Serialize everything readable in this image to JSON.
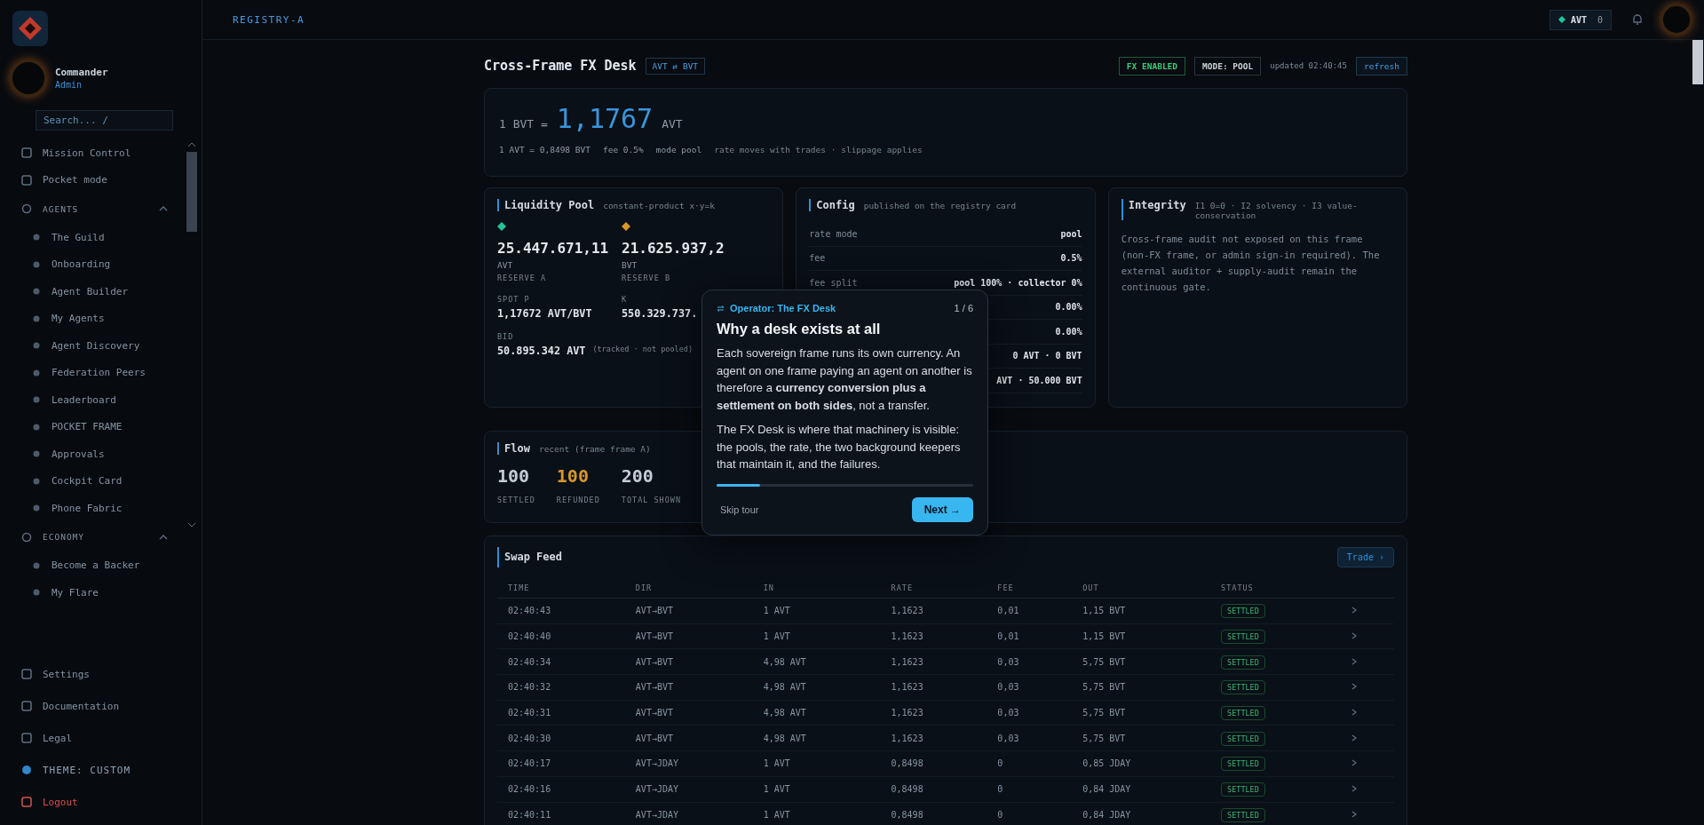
{
  "sidebar": {
    "user": {
      "name": "Commander",
      "role": "Admin"
    },
    "search": {
      "placeholder": "Search... /"
    },
    "items": [
      {
        "label": "Mission Control",
        "kind": "link"
      },
      {
        "label": "Pocket mode",
        "kind": "link"
      },
      {
        "label": "AGENTS",
        "kind": "section",
        "expanded": true,
        "children": [
          {
            "label": "The Guild"
          },
          {
            "label": "Onboarding"
          },
          {
            "label": "Agent Builder"
          },
          {
            "label": "My Agents"
          },
          {
            "label": "Agent Discovery"
          },
          {
            "label": "Federation Peers"
          },
          {
            "label": "Leaderboard"
          },
          {
            "label": "POCKET FRAME"
          },
          {
            "label": "Approvals"
          },
          {
            "label": "Cockpit Card"
          },
          {
            "label": "Phone Fabric"
          }
        ]
      },
      {
        "label": "ECONOMY",
        "kind": "section",
        "expanded": true,
        "children": [
          {
            "label": "Become a Backer"
          },
          {
            "label": "My Flare"
          }
        ]
      }
    ],
    "footer": [
      {
        "label": "Settings",
        "kind": "link"
      },
      {
        "label": "Documentation",
        "kind": "link"
      },
      {
        "label": "Legal",
        "kind": "link"
      },
      {
        "label": "THEME: CUSTOM",
        "kind": "theme"
      },
      {
        "label": "Logout",
        "kind": "danger"
      }
    ]
  },
  "topbar": {
    "frame": "REGISTRY-A",
    "currency": "AVT",
    "balance": "0"
  },
  "header": {
    "title": "Cross-Frame FX Desk",
    "pair": "AVT ⇄ BVT",
    "status": "FX ENABLED",
    "mode": "MODE: POOL",
    "updated": "updated 02:40:45",
    "refresh": "refresh"
  },
  "rate": {
    "base": "1 BVT =",
    "value": "1,1767",
    "quote": "AVT",
    "facts": [
      "1 AVT = 0,8498 BVT",
      "fee 0.5%",
      "mode pool",
      "rate moves with trades · slippage applies"
    ]
  },
  "pool": {
    "title": "Liquidity Pool",
    "subtitle": "constant-product x·y=k",
    "reserves": [
      {
        "value": "25.447.671,11",
        "unit": "AVT",
        "label": "RESERVE A",
        "color": "#22c49a"
      },
      {
        "value": "21.625.937,2",
        "unit": "BVT",
        "label": "RESERVE B",
        "color": "#d9952e"
      }
    ],
    "stats": [
      {
        "label": "SPOT P",
        "value": "1,17672 AVT/BVT"
      },
      {
        "label": "K",
        "value": "550.329.737."
      }
    ],
    "bid": {
      "label": "BID",
      "value": "50.895.342 AVT",
      "note": "(tracked · not pooled)"
    }
  },
  "config": {
    "title": "Config",
    "subtitle": "published on the registry card",
    "rows": [
      {
        "label": "rate mode",
        "value": "pool"
      },
      {
        "label": "fee",
        "value": "0.5%"
      },
      {
        "label": "fee split",
        "value": "pool 100% · collector 0%"
      },
      {
        "value": "0.00%"
      },
      {
        "value": "0.00%"
      },
      {
        "value": "0 AVT · 0 BVT"
      },
      {
        "value": "AVT · 50.000 BVT"
      }
    ]
  },
  "integrity": {
    "title": "Integrity",
    "subtitle": "I1 0=0 · I2 solvency · I3 value-conservation",
    "text": "Cross-frame audit not exposed on this frame (non-FX frame, or admin sign-in required). The external auditor + supply-audit remain the continuous gate."
  },
  "flow": {
    "title": "Flow",
    "subtitle": "recent (frame frame A)",
    "stats": [
      {
        "value": "100",
        "label": "SETTLED",
        "kind": "plain"
      },
      {
        "value": "100",
        "label": "REFUNDED",
        "kind": "warn"
      },
      {
        "value": "200",
        "label": "TOTAL SHOWN",
        "kind": "plain"
      }
    ]
  },
  "swap_feed": {
    "title": "Swap Feed",
    "action": "Trade ›",
    "columns": [
      "TIME",
      "DIR",
      "IN",
      "RATE",
      "FEE",
      "OUT",
      "STATUS"
    ],
    "rows": [
      [
        "02:40:43",
        "AVT→BVT",
        "1 AVT",
        "1,1623",
        "0,01",
        "1,15 BVT",
        "SETTLED"
      ],
      [
        "02:40:40",
        "AVT→BVT",
        "1 AVT",
        "1,1623",
        "0,01",
        "1,15 BVT",
        "SETTLED"
      ],
      [
        "02:40:34",
        "AVT→BVT",
        "4,98 AVT",
        "1,1623",
        "0,03",
        "5,75 BVT",
        "SETTLED"
      ],
      [
        "02:40:32",
        "AVT→BVT",
        "4,98 AVT",
        "1,1623",
        "0,03",
        "5,75 BVT",
        "SETTLED"
      ],
      [
        "02:40:31",
        "AVT→BVT",
        "4,98 AVT",
        "1,1623",
        "0,03",
        "5,75 BVT",
        "SETTLED"
      ],
      [
        "02:40:30",
        "AVT→BVT",
        "4,98 AVT",
        "1,1623",
        "0,03",
        "5,75 BVT",
        "SETTLED"
      ],
      [
        "02:40:17",
        "AVT→JDAY",
        "1 AVT",
        "0,8498",
        "0",
        "0,85 JDAY",
        "SETTLED"
      ],
      [
        "02:40:16",
        "AVT→JDAY",
        "1 AVT",
        "0,8498",
        "0",
        "0,84 JDAY",
        "SETTLED"
      ],
      [
        "02:40:11",
        "AVT→JDAY",
        "1 AVT",
        "0,8498",
        "0",
        "0,84 JDAY",
        "SETTLED"
      ]
    ]
  },
  "tour": {
    "eyebrow": "Operator: The FX Desk",
    "step": "1 / 6",
    "title": "Why a desk exists at all",
    "paragraphs": [
      "Each sovereign frame runs its own currency. An agent on one frame paying an agent on another is therefore a **currency conversion plus a settlement on both sides**, not a transfer.",
      "The FX Desk is where that machinery is visible: the pools, the rate, the two background keepers that maintain it, and the failures."
    ],
    "level": 0.17,
    "skip": "Skip tour",
    "next": "Next →"
  }
}
